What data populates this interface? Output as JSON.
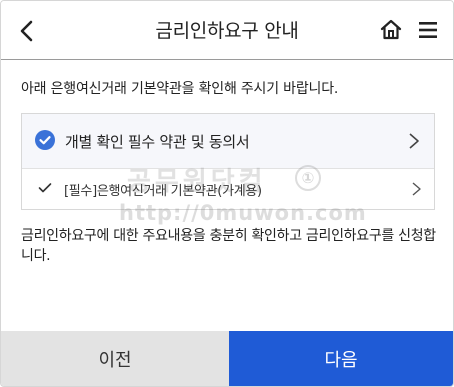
{
  "header": {
    "title": "금리인하요구 안내"
  },
  "intro_text": "아래 은행여신거래 기본약관을 확인해 주시기 바랍니다.",
  "agreement": {
    "main_label": "개별 확인 필수 약관 및 동의서",
    "main_checked": true,
    "items": [
      {
        "label": "[필수]은행여신거래 기본약관(가계용)",
        "checked": true
      }
    ]
  },
  "watermark": {
    "text": "공무원닷컴",
    "badge": "①",
    "url": "http://0muwon.com"
  },
  "notice_text": "금리인하요구에 대한 주요내용을 충분히 확인하고 금리인하요구를 신청합니다.",
  "footer": {
    "prev_label": "이전",
    "next_label": "다음"
  },
  "colors": {
    "accent": "#1f5bd6",
    "check": "#3a72d8",
    "prev_bg": "#e3e3e3"
  }
}
